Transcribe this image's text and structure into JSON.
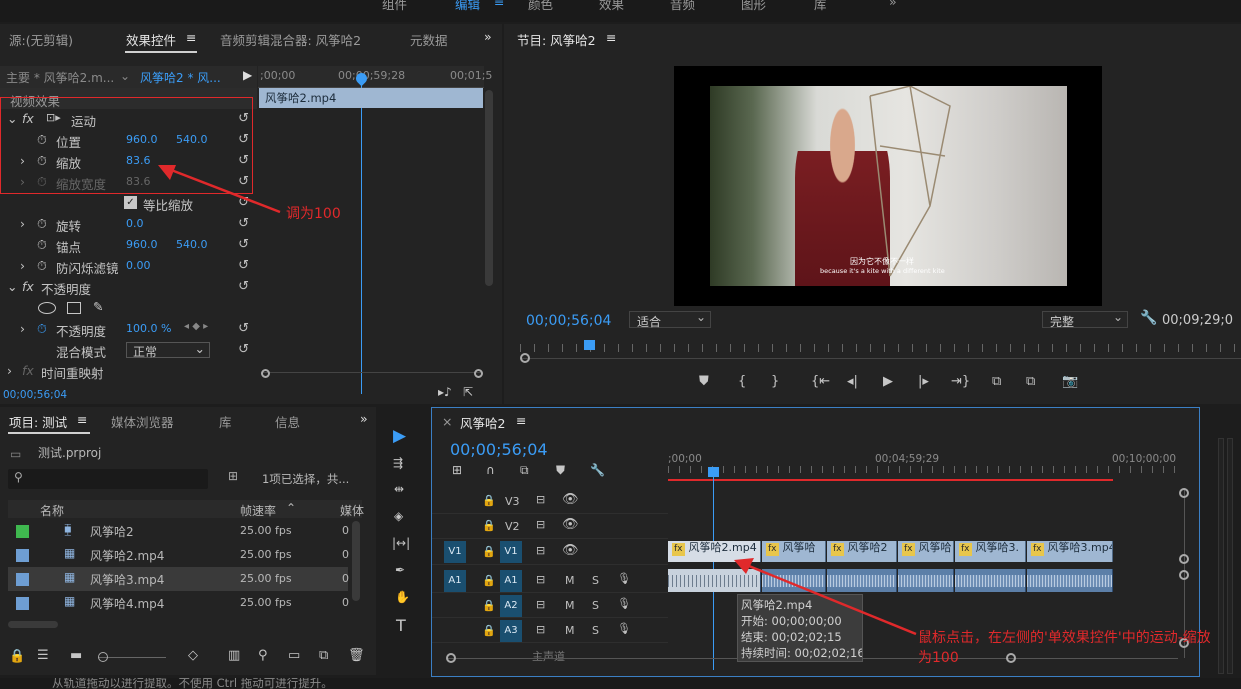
{
  "topbar": {
    "tabs": [
      "组件",
      "编辑",
      "颜色",
      "效果",
      "音频",
      "图形",
      "库"
    ],
    "more": "»"
  },
  "source_panel": {
    "tabs": [
      "源:(无剪辑)",
      "效果控件",
      "音频剪辑混合器: 风筝哈2",
      "元数据"
    ],
    "menu_icon": "≡",
    "more": "»",
    "master_label": "主要 * 风筝哈2.m...",
    "sequence_label": "风筝哈2 * 风...",
    "ruler": {
      "t0": ";00;00",
      "t1": "00;00;59;28",
      "t2": "00;01;5"
    },
    "clip_name": "风筝哈2.mp4",
    "video_effects": "视频效果",
    "motion": "运动",
    "position": {
      "label": "位置",
      "x": "960.0",
      "y": "540.0"
    },
    "scale": {
      "label": "缩放",
      "value": "83.6"
    },
    "scale_width": {
      "label": "缩放宽度",
      "value": "83.6"
    },
    "uniform_scale": "等比缩放",
    "rotation": {
      "label": "旋转",
      "value": "0.0"
    },
    "anchor": {
      "label": "锚点",
      "x": "960.0",
      "y": "540.0"
    },
    "antiflicker": {
      "label": "防闪烁滤镜",
      "value": "0.00"
    },
    "opacity_group": "不透明度",
    "opacity": {
      "label": "不透明度",
      "value": "100.0 %"
    },
    "blend": {
      "label": "混合模式",
      "value": "正常"
    },
    "time_remap": "时间重映射",
    "timecode": "00;00;56;04"
  },
  "program_monitor": {
    "title": "节目: 风筝哈2",
    "menu_icon": "≡",
    "subtitle_cn": "因为它不像不一样",
    "subtitle_en": "because it's a kite with a different kite",
    "timecode_left": "00;00;56;04",
    "fit": "适合",
    "quality": "完整",
    "timecode_right": "00;09;29;0"
  },
  "annotation_top": "调为100",
  "annotation_bottom": "鼠标点击，在左侧的'单效果控件'中的运动-缩放,调为100",
  "project_panel": {
    "tabs": [
      "项目: 测试",
      "媒体浏览器",
      "库",
      "信息"
    ],
    "menu_icon": "≡",
    "more": "»",
    "file": "测试.prproj",
    "search_placeholder": "",
    "selection_info": "1项已选择，共...",
    "columns": {
      "name": "名称",
      "fps": "帧速率",
      "media": "媒体"
    },
    "rows": [
      {
        "name": "风筝哈2",
        "fps": "25.00 fps",
        "media": "0",
        "color": "#3fb84f"
      },
      {
        "name": "风筝哈2.mp4",
        "fps": "25.00 fps",
        "media": "0",
        "color": "#6e9ed3"
      },
      {
        "name": "风筝哈3.mp4",
        "fps": "25.00 fps",
        "media": "0",
        "color": "#6e9ed3"
      },
      {
        "name": "风筝哈4.mp4",
        "fps": "25.00 fps",
        "media": "0",
        "color": "#6e9ed3"
      }
    ]
  },
  "timeline": {
    "close": "×",
    "title": "风筝哈2",
    "menu_icon": "≡",
    "timecode": "00;00;56;04",
    "ruler": {
      "t0": ";00;00",
      "t1": "00;04;59;29",
      "t2": "00;10;00;00"
    },
    "tracks": {
      "v3": "V3",
      "v2": "V2",
      "v1": "V1",
      "a1": "A1",
      "a2": "A2",
      "a3": "A3",
      "v1_src": "V1",
      "a1_src": "A1",
      "m": "M",
      "s": "S"
    },
    "clips": [
      {
        "label": "风筝哈2.mp4 [V]"
      },
      {
        "label": "风筝哈"
      },
      {
        "label": "风筝哈2"
      },
      {
        "label": "风筝哈"
      },
      {
        "label": "风筝哈3."
      },
      {
        "label": "风筝哈3.mp4"
      }
    ],
    "tooltip": {
      "name": "风筝哈2.mp4",
      "start": "开始: 00;00;00;00",
      "end": "结束: 00;02;02;15",
      "duration": "持续时间: 00;02;02;16"
    },
    "master": "主声道"
  },
  "statusbar": "从轨道拖动以进行提取。不使用 Ctrl 拖动可进行提升。",
  "colors": {
    "accent": "#3b9cf5",
    "annotation": "#e0292b",
    "clip_video": "#9fb7d2",
    "clip_audio": "#5c7fa8"
  }
}
